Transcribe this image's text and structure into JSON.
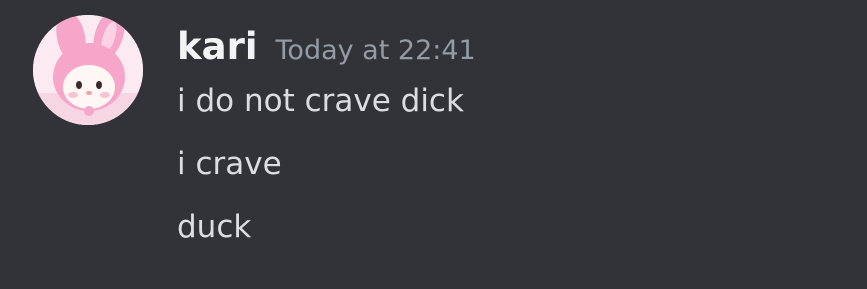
{
  "message": {
    "author": {
      "name": "kari",
      "avatar_icon": "pink-rabbit-hood-character-avatar"
    },
    "timestamp": "Today at 22:41",
    "lines": [
      "i do not crave dick",
      "i crave",
      "duck"
    ]
  },
  "colors": {
    "background": "#313338",
    "username": "#f2f3f5",
    "timestamp": "#949ba4",
    "message_text": "#dbdee1",
    "avatar_hood": "#f6a6c8"
  }
}
